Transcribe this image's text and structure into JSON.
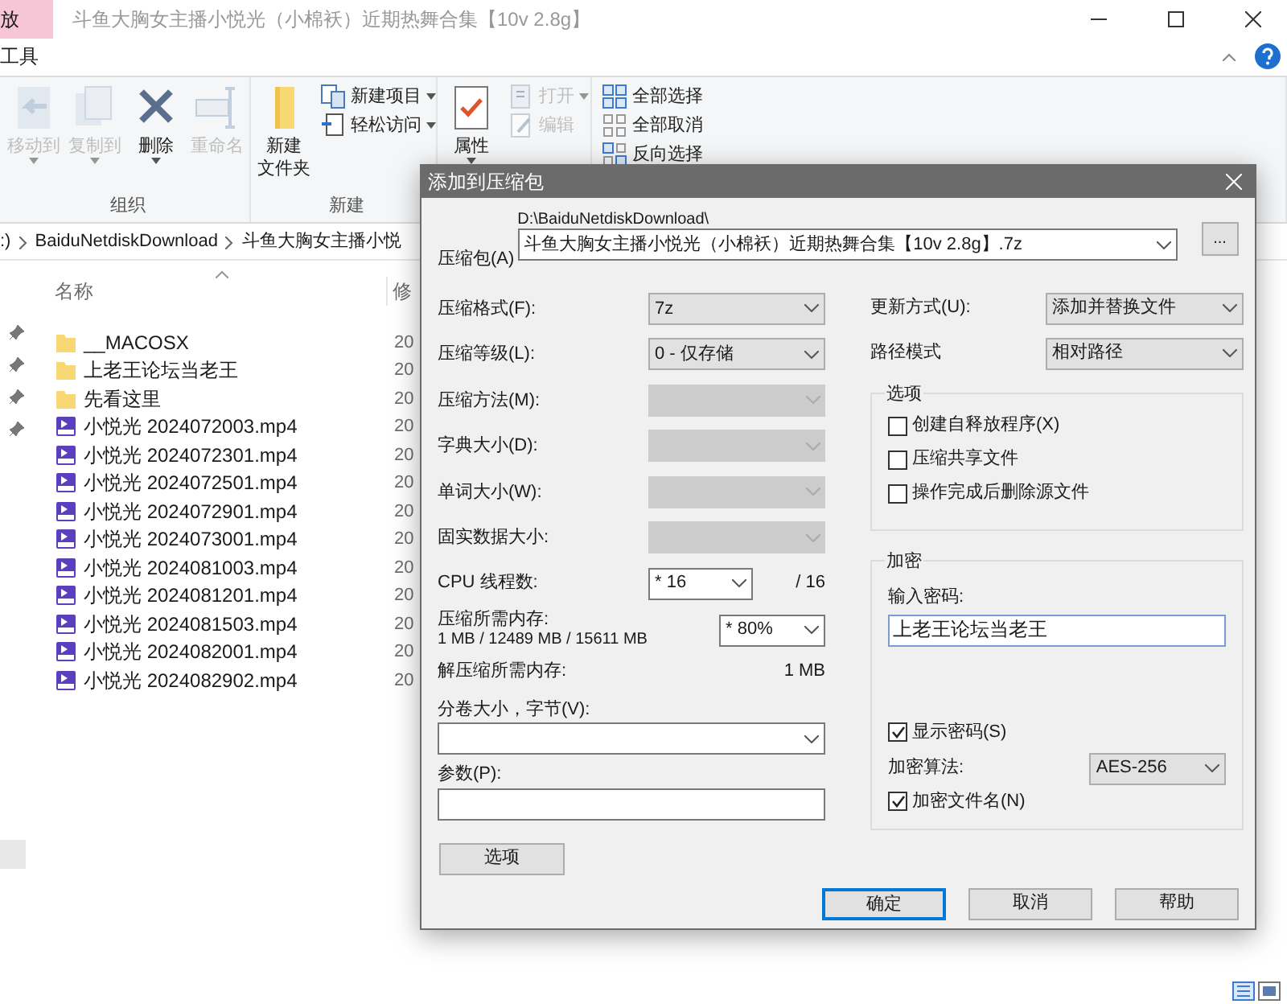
{
  "explorer": {
    "tabs": [
      {
        "label": "放",
        "selected": true
      },
      {
        "label": "工具",
        "selected": false
      }
    ],
    "title": "斗鱼大胸女主播小悦光（小棉袄）近期热舞合集【10v 2.8g】",
    "ribbon_groups": [
      {
        "label": "组织",
        "items": [
          {
            "kind": "move",
            "label": "移动到",
            "disabled": true,
            "dropdown": true
          },
          {
            "kind": "copy",
            "label": "复制到",
            "disabled": true,
            "dropdown": true
          },
          {
            "kind": "delete",
            "label": "删除",
            "disabled": false,
            "dropdown": true
          },
          {
            "kind": "rename",
            "label": "重命名",
            "disabled": true,
            "dropdown": false
          }
        ]
      },
      {
        "label": "新建",
        "items": [
          {
            "kind": "newfolder",
            "label": "新建",
            "label_2": "文件夹",
            "disabled": false,
            "dropdown": false
          },
          {
            "kind": "newitem",
            "label": "新建项目",
            "disabled": false,
            "dropdown": true
          },
          {
            "kind": "easyaccess",
            "label": "轻松访问",
            "disabled": false,
            "dropdown": true
          }
        ]
      },
      {
        "items": [
          {
            "kind": "properties",
            "label": "属性",
            "disabled": false,
            "dropdown": true
          },
          {
            "kind": "open",
            "label": "打开",
            "disabled": true,
            "dropdown": true
          },
          {
            "kind": "edit",
            "label": "编辑",
            "disabled": true,
            "dropdown": false
          }
        ]
      },
      {
        "items": [
          {
            "kind": "selectall",
            "label": "全部选择",
            "disabled": false,
            "dropdown": false
          },
          {
            "kind": "selectnone",
            "label": "全部取消",
            "disabled": false,
            "dropdown": false
          },
          {
            "kind": "invert",
            "label": "反向选择",
            "disabled": false,
            "dropdown": false
          }
        ]
      }
    ],
    "breadcrumbs": [
      ":)",
      "BaiduNetdiskDownload",
      "斗鱼大胸女主播小悦"
    ],
    "columns": [
      "名称",
      "修"
    ],
    "files": [
      {
        "kind": "folder",
        "name": "__MACOSX",
        "column_2": "20"
      },
      {
        "kind": "folder",
        "name": "上老王论坛当老王",
        "column_2": "20"
      },
      {
        "kind": "folder",
        "name": "先看这里",
        "column_2": "20"
      },
      {
        "kind": "video",
        "name": "小悦光 2024072003.mp4",
        "column_2": "20"
      },
      {
        "kind": "video",
        "name": "小悦光 2024072301.mp4",
        "column_2": "20"
      },
      {
        "kind": "video",
        "name": "小悦光 2024072501.mp4",
        "column_2": "20"
      },
      {
        "kind": "video",
        "name": "小悦光 2024072901.mp4",
        "column_2": "20"
      },
      {
        "kind": "video",
        "name": "小悦光 2024073001.mp4",
        "column_2": "20"
      },
      {
        "kind": "video",
        "name": "小悦光 2024081003.mp4",
        "column_2": "20"
      },
      {
        "kind": "video",
        "name": "小悦光 2024081201.mp4",
        "column_2": "20"
      },
      {
        "kind": "video",
        "name": "小悦光 2024081503.mp4",
        "column_2": "20"
      },
      {
        "kind": "video",
        "name": "小悦光 2024082001.mp4",
        "column_2": "20"
      },
      {
        "kind": "video",
        "name": "小悦光 2024082902.mp4",
        "column_2": "20"
      }
    ]
  },
  "dialog": {
    "title": "添加到压缩包",
    "archive": {
      "label": "压缩包(A)",
      "path": "D:\\BaiduNetdiskDownload\\",
      "value": "斗鱼大胸女主播小悦光（小棉袄）近期热舞合集【10v 2.8g】.7z",
      "browse": "..."
    },
    "left_fields": [
      {
        "label": "压缩格式(F):",
        "value": "7z",
        "disabled": false
      },
      {
        "label": "压缩等级(L):",
        "value": "0 - 仅存储",
        "disabled": false
      },
      {
        "label": "压缩方法(M):",
        "disabled": true
      },
      {
        "label": "字典大小(D):",
        "disabled": true
      },
      {
        "label": "单词大小(W):",
        "disabled": true
      },
      {
        "label": "固实数据大小:",
        "disabled": true
      }
    ],
    "cpu": {
      "label": "CPU 线程数:",
      "value": "* 16",
      "total": "/ 16"
    },
    "memory": {
      "label": "压缩所需内存:",
      "detail": "1 MB / 12489 MB / 15611 MB",
      "value": "* 80%"
    },
    "decompress": {
      "label": "解压缩所需内存:",
      "value": "1 MB"
    },
    "split": {
      "label": "分卷大小，字节(V):"
    },
    "params": {
      "label": "参数(P):"
    },
    "options_button": "选项",
    "update": {
      "label": "更新方式(U):",
      "value": "添加并替换文件"
    },
    "path_mode": {
      "label": "路径模式",
      "value": "相对路径"
    },
    "options": {
      "title": "选项",
      "checkboxes": [
        {
          "label": "创建自释放程序(X)",
          "checked": false
        },
        {
          "label": "压缩共享文件",
          "checked": false
        },
        {
          "label": "操作完成后删除源文件",
          "checked": false
        }
      ]
    },
    "encryption": {
      "title": "加密",
      "password_label": "输入密码:",
      "password": "上老王论坛当老王",
      "show_password": {
        "label": "显示密码(S)",
        "checked": true
      },
      "method_label": "加密算法:",
      "method": "AES-256",
      "encrypt_names": {
        "label": "加密文件名(N)",
        "checked": true
      }
    },
    "buttons": [
      {
        "label": "确定",
        "selected": true
      },
      {
        "label": "取消",
        "selected": false
      },
      {
        "label": "帮助",
        "selected": false
      }
    ]
  }
}
